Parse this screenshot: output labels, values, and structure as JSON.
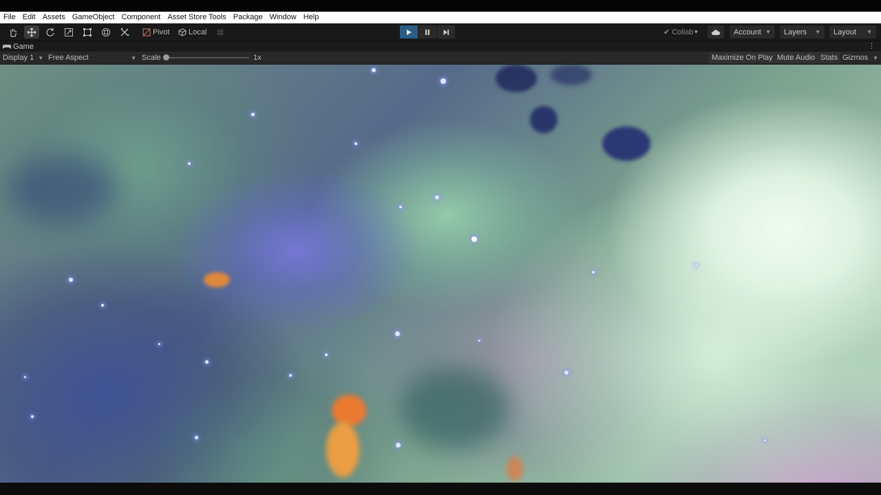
{
  "menu": [
    "File",
    "Edit",
    "Assets",
    "GameObject",
    "Component",
    "Asset Store Tools",
    "Package",
    "Window",
    "Help"
  ],
  "toolbar": {
    "tools": [
      "hand-tool-icon",
      "move-tool-icon",
      "rotate-tool-icon",
      "scale-tool-icon",
      "rect-tool-icon",
      "transform-tool-icon",
      "custom-tool-icon"
    ],
    "pivot_label": "Pivot",
    "local_label": "Local",
    "collab_label": "Collab",
    "account_label": "Account",
    "layers_label": "Layers",
    "layout_label": "Layout",
    "play_active": true
  },
  "game_tab": {
    "label": "Game",
    "display": "Display 1",
    "aspect": "Free Aspect",
    "scale_label": "Scale",
    "scale_value": "1x",
    "maximize_label": "Maximize On Play",
    "mute_label": "Mute Audio",
    "stats_label": "Stats",
    "gizmos_label": "Gizmos"
  },
  "colors": {
    "menubar_bg": "#ffffff",
    "toolbar_bg": "#191919",
    "play_active": "#2c5d87",
    "nebula_green": "#b9d7c0",
    "nebula_blue": "#6470c8"
  }
}
